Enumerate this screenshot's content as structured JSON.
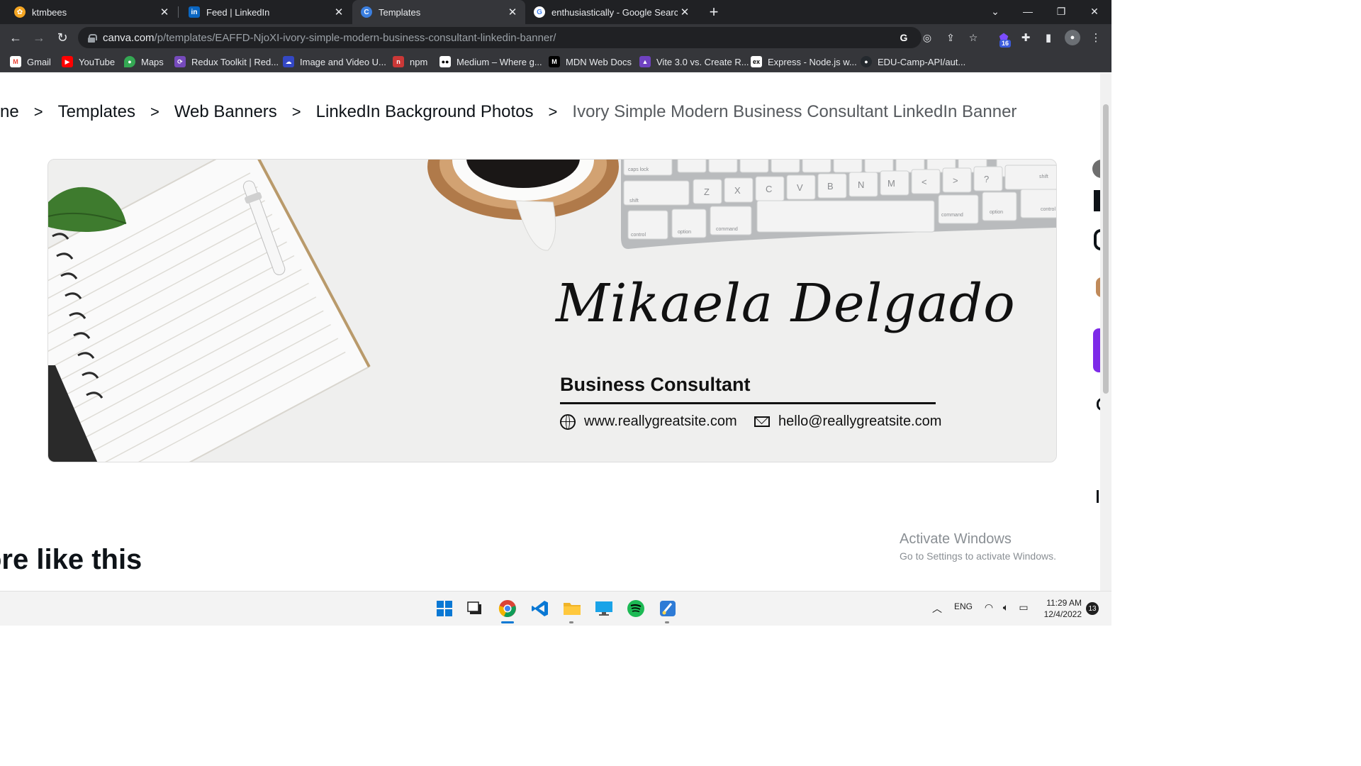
{
  "browser": {
    "tabs": [
      {
        "title": "ktmbees",
        "active": false
      },
      {
        "title": "Feed | LinkedIn",
        "active": false
      },
      {
        "title": "Templates",
        "active": true
      },
      {
        "title": "enthusiastically - Google Search",
        "active": false
      }
    ],
    "url_host": "canva.com",
    "url_path": "/p/templates/EAFFD-NjoXI-ivory-simple-modern-business-consultant-linkedin-banner/",
    "extension_badge": "16",
    "bookmarks": [
      {
        "label": "Gmail",
        "icon": "gmail-icon"
      },
      {
        "label": "YouTube",
        "icon": "youtube-icon"
      },
      {
        "label": "Maps",
        "icon": "maps-icon"
      },
      {
        "label": "Redux Toolkit | Red...",
        "icon": "redux-icon"
      },
      {
        "label": "Image and Video U...",
        "icon": "cloud-icon"
      },
      {
        "label": "npm",
        "icon": "npm-icon"
      },
      {
        "label": "Medium – Where g...",
        "icon": "medium-icon"
      },
      {
        "label": "MDN Web Docs",
        "icon": "mdn-icon"
      },
      {
        "label": "Vite 3.0 vs. Create R...",
        "icon": "vite-icon"
      },
      {
        "label": "Express - Node.js w...",
        "icon": "express-icon"
      },
      {
        "label": "EDU-Camp-API/aut...",
        "icon": "github-icon"
      }
    ]
  },
  "page": {
    "breadcrumb_home_partial": "ne",
    "breadcrumbs": [
      "Templates",
      "Web Banners",
      "LinkedIn Background Photos"
    ],
    "breadcrumb_current": "Ivory Simple Modern Business Consultant LinkedIn Banner",
    "banner": {
      "signature": "Mikaela Delgado",
      "role": "Business Consultant",
      "website": "www.reallygreatsite.com",
      "email": "hello@reallygreatsite.com",
      "keyboard_keys": [
        "caps lock",
        "shift",
        "control",
        "option",
        "command",
        "Z",
        "X",
        "C",
        "V",
        "B",
        "N",
        "M",
        "<",
        ">",
        "?",
        "command",
        "option",
        "shift",
        "control"
      ]
    },
    "more_like_this": "ore like this"
  },
  "watermark": {
    "title": "Activate Windows",
    "subtitle": "Go to Settings to activate Windows."
  },
  "taskbar": {
    "language": "ENG",
    "time": "11:29 AM",
    "date": "12/4/2022",
    "notifications": "13"
  }
}
